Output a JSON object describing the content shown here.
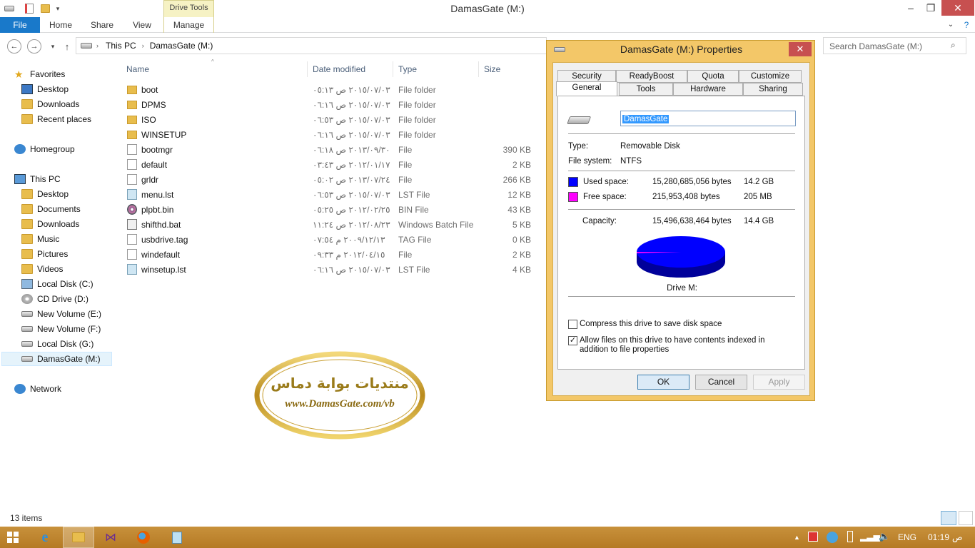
{
  "window": {
    "title": "DamasGate (M:)",
    "contextual_tab": "Drive Tools"
  },
  "ribbon": {
    "tabs": [
      "File",
      "Home",
      "Share",
      "View",
      "Manage"
    ]
  },
  "address": {
    "crumbs": [
      "This PC",
      "DamasGate (M:)"
    ],
    "search_placeholder": "Search DamasGate (M:)"
  },
  "nav": {
    "favorites": "Favorites",
    "favorite_items": [
      "Desktop",
      "Downloads",
      "Recent places"
    ],
    "homegroup": "Homegroup",
    "thispc": "This PC",
    "pc_items": [
      "Desktop",
      "Documents",
      "Downloads",
      "Music",
      "Pictures",
      "Videos",
      "Local Disk (C:)",
      "CD Drive (D:)",
      "New Volume (E:)",
      "New Volume (F:)",
      "Local Disk (G:)",
      "DamasGate (M:)"
    ],
    "network": "Network"
  },
  "columns": {
    "name": "Name",
    "date": "Date modified",
    "type": "Type",
    "size": "Size"
  },
  "files": [
    {
      "name": "boot",
      "date": "٢٠١٥/٠٧/٠٣ ص ٠٥:١٣",
      "type": "File folder",
      "size": "",
      "icon": "folder"
    },
    {
      "name": "DPMS",
      "date": "٢٠١٥/٠٧/٠٣ ص ٠٦:١٦",
      "type": "File folder",
      "size": "",
      "icon": "folder"
    },
    {
      "name": "ISO",
      "date": "٢٠١٥/٠٧/٠٣ ص ٠٦:٥٣",
      "type": "File folder",
      "size": "",
      "icon": "folder"
    },
    {
      "name": "WINSETUP",
      "date": "٢٠١٥/٠٧/٠٣ ص ٠٦:١٦",
      "type": "File folder",
      "size": "",
      "icon": "folder"
    },
    {
      "name": "bootmgr",
      "date": "٢٠١٣/٠٩/٣٠ ص ٠٦:١٨",
      "type": "File",
      "size": "390 KB",
      "icon": "doc"
    },
    {
      "name": "default",
      "date": "٢٠١٢/٠١/١٧ ص ٠٣:٤٣",
      "type": "File",
      "size": "2 KB",
      "icon": "doc"
    },
    {
      "name": "grldr",
      "date": "٢٠١٣/٠٧/٢٤ ص ٠٥:٠٢",
      "type": "File",
      "size": "266 KB",
      "icon": "doc"
    },
    {
      "name": "menu.lst",
      "date": "٢٠١٥/٠٧/٠٣ ص ٠٦:٥٣",
      "type": "LST File",
      "size": "12 KB",
      "icon": "lst"
    },
    {
      "name": "plpbt.bin",
      "date": "٢٠١٢/٠٢/٢٥ ص ٠٥:٢٥",
      "type": "BIN File",
      "size": "43 KB",
      "icon": "bin"
    },
    {
      "name": "shifthd.bat",
      "date": "٢٠١٢/٠٨/٢٣ ص ١١:٢٤",
      "type": "Windows Batch File",
      "size": "5 KB",
      "icon": "bat"
    },
    {
      "name": "usbdrive.tag",
      "date": "٢٠٠٩/١٢/١٣ م ٠٧:٥٤",
      "type": "TAG File",
      "size": "0 KB",
      "icon": "doc"
    },
    {
      "name": "windefault",
      "date": "٢٠١٢/٠٤/١٥ م ٠٩:٣٣",
      "type": "File",
      "size": "2 KB",
      "icon": "doc"
    },
    {
      "name": "winsetup.lst",
      "date": "٢٠١٥/٠٧/٠٣ ص ٠٦:١٦",
      "type": "LST File",
      "size": "4 KB",
      "icon": "lst"
    }
  ],
  "status": {
    "count": "13 items"
  },
  "watermark": {
    "arabic": "منتديات بوابة دماس",
    "url": "www.DamasGate.com/vb"
  },
  "dialog": {
    "title": "DamasGate (M:) Properties",
    "tabs_row1": [
      "Security",
      "ReadyBoost",
      "Quota",
      "Customize"
    ],
    "tabs_row2": [
      "General",
      "Tools",
      "Hardware",
      "Sharing"
    ],
    "name_value": "DamasGate",
    "type_label": "Type:",
    "type_value": "Removable Disk",
    "fs_label": "File system:",
    "fs_value": "NTFS",
    "used_label": "Used space:",
    "used_bytes": "15,280,685,056 bytes",
    "used_gb": "14.2 GB",
    "free_label": "Free space:",
    "free_bytes": "215,953,408 bytes",
    "free_gb": "205 MB",
    "cap_label": "Capacity:",
    "cap_bytes": "15,496,638,464 bytes",
    "cap_gb": "14.4 GB",
    "drive_label": "Drive M:",
    "used_color": "#0000ff",
    "free_color": "#ff00ff",
    "used_fraction": 0.986,
    "compress": "Compress this drive to save disk space",
    "index": "Allow files on this drive to have contents indexed in addition to file properties",
    "compress_checked": false,
    "index_checked": true,
    "ok": "OK",
    "cancel": "Cancel",
    "apply": "Apply"
  },
  "taskbar": {
    "lang": "ENG",
    "time": "01:19",
    "ampm": "ص"
  }
}
